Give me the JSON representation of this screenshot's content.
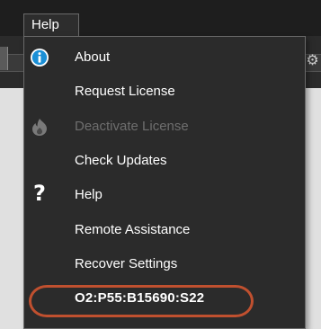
{
  "menubar": {
    "help_label": "Help"
  },
  "help_menu": {
    "items": [
      {
        "label": "About",
        "icon": "info-icon",
        "enabled": true
      },
      {
        "label": "Request License",
        "icon": "",
        "enabled": true
      },
      {
        "label": "Deactivate License",
        "icon": "fire-icon",
        "enabled": false
      },
      {
        "label": "Check Updates",
        "icon": "",
        "enabled": true
      },
      {
        "label": "Help",
        "icon": "question-icon",
        "enabled": true
      },
      {
        "label": "Remote Assistance",
        "icon": "",
        "enabled": true
      },
      {
        "label": "Recover Settings",
        "icon": "",
        "enabled": true
      },
      {
        "label": "O2:P55:B15690:S22",
        "icon": "",
        "enabled": true
      }
    ]
  },
  "colors": {
    "menu_background": "#2b2b2b",
    "menu_text": "#ffffff",
    "disabled_text": "#6e6e6e",
    "info_icon": "#1a8fd6",
    "highlight_ring": "#c0502f"
  }
}
